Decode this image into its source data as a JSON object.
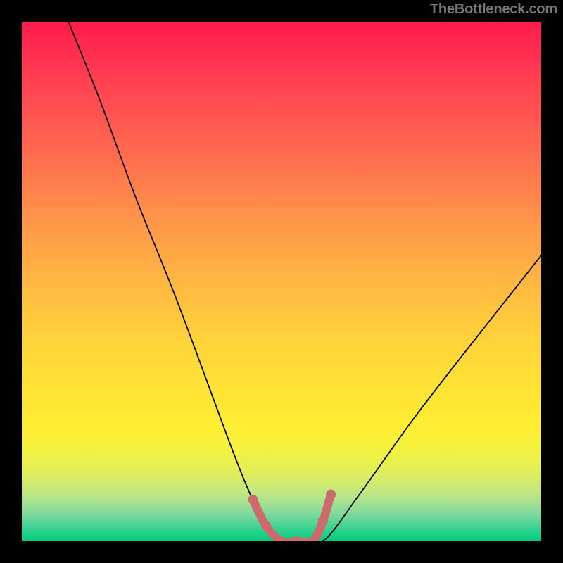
{
  "watermark": "TheBottleneck.com",
  "chart_data": {
    "type": "line",
    "title": "",
    "xlabel": "",
    "ylabel": "",
    "xlim": [
      0,
      100
    ],
    "ylim": [
      0,
      100
    ],
    "gradient_stops": [
      {
        "pos": 0,
        "color": "#ff1a4d"
      },
      {
        "pos": 10,
        "color": "#ff3c52"
      },
      {
        "pos": 25,
        "color": "#ff6a4f"
      },
      {
        "pos": 38,
        "color": "#ff944a"
      },
      {
        "pos": 50,
        "color": "#ffb742"
      },
      {
        "pos": 62,
        "color": "#ffd53a"
      },
      {
        "pos": 72,
        "color": "#ffe534"
      },
      {
        "pos": 78,
        "color": "#ffee33"
      },
      {
        "pos": 82,
        "color": "#f4f23c"
      },
      {
        "pos": 86,
        "color": "#e5ef55"
      },
      {
        "pos": 89,
        "color": "#d0ea71"
      },
      {
        "pos": 92,
        "color": "#b0e38e"
      },
      {
        "pos": 95,
        "color": "#7ad89e"
      },
      {
        "pos": 98,
        "color": "#2ed190"
      },
      {
        "pos": 100,
        "color": "#00cf7a"
      }
    ],
    "series": [
      {
        "name": "curve",
        "color": "#000000",
        "x": [
          9,
          15,
          22,
          30,
          40,
          44,
          47,
          50,
          53,
          58,
          65,
          75,
          85,
          100
        ],
        "y": [
          100,
          85,
          66,
          46,
          19,
          9,
          3,
          0,
          0,
          0,
          9,
          23,
          36,
          55
        ]
      }
    ],
    "markers": {
      "comment": "Thick pink stroke segment at bottom of curve, with dots",
      "color": "#cc6b6b",
      "stroke_width_px": 12,
      "dot_radius_px": 7,
      "range_x": [
        44,
        58
      ],
      "points": [
        {
          "x": 44.5,
          "y": 8
        },
        {
          "x": 47,
          "y": 3
        },
        {
          "x": 50,
          "y": 0
        },
        {
          "x": 53,
          "y": 0
        },
        {
          "x": 56,
          "y": 0
        },
        {
          "x": 58,
          "y": 4
        },
        {
          "x": 59.5,
          "y": 9
        }
      ]
    }
  }
}
